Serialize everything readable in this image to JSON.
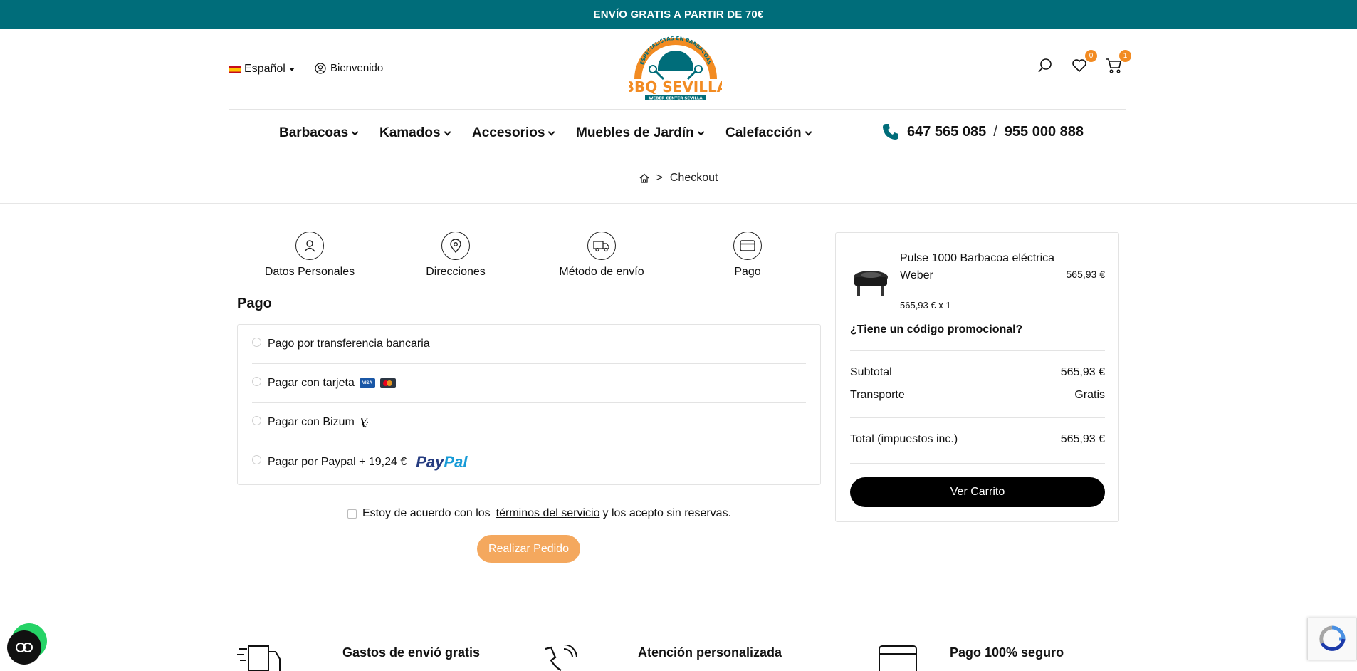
{
  "promo_bar": {
    "text": "ENVÍO GRATIS A PARTIR DE 70€"
  },
  "header": {
    "language": "Español",
    "welcome": "Bienvenido",
    "logo": {
      "brand": "BBQ SEVILLA",
      "arc_text": "ESPECIALISTAS EN BARBACOAS",
      "sub_text": "WEBER CENTER SEVILLA"
    },
    "wishlist_count": "0",
    "cart_count": "1"
  },
  "nav": {
    "items": [
      {
        "label": "Barbacoas"
      },
      {
        "label": "Kamados"
      },
      {
        "label": "Accesorios"
      },
      {
        "label": "Muebles de Jardín"
      },
      {
        "label": "Calefacción"
      }
    ],
    "phone_1": "647 565 085",
    "phone_separator": "/",
    "phone_2": "955 000 888"
  },
  "breadcrumb": {
    "separator": ">",
    "current": "Checkout"
  },
  "steps": [
    {
      "label": "Datos Personales",
      "icon": "user-icon"
    },
    {
      "label": "Direcciones",
      "icon": "location-pin-icon"
    },
    {
      "label": "Método de envío",
      "icon": "truck-icon"
    },
    {
      "label": "Pago",
      "icon": "credit-card-icon"
    }
  ],
  "payment": {
    "title": "Pago",
    "options": [
      {
        "label": "Pago por transferencia bancaria"
      },
      {
        "label": "Pagar con tarjeta"
      },
      {
        "label": "Pagar con Bizum"
      },
      {
        "label": "Pagar por Paypal + 19,24 €",
        "brand_a": "Pay",
        "brand_b": "Pal"
      }
    ],
    "card_logos": [
      "VISA",
      "mastercard"
    ]
  },
  "terms": {
    "before": "Estoy de acuerdo con los",
    "link": "términos del servicio",
    "after": "y los acepto sin reservas."
  },
  "place_order_label": "Realizar Pedido",
  "summary": {
    "product_name": "Pulse 1000 Barbacoa eléctrica Weber",
    "product_unit_price": "565,93 €",
    "product_qty_sep": "x",
    "product_qty": "1",
    "product_total": "565,93 €",
    "promo_label": "¿Tiene un código promocional?",
    "subtotal_label": "Subtotal",
    "subtotal_value": "565,93 €",
    "shipping_label": "Transporte",
    "shipping_value": "Gratis",
    "total_label": "Total (impuestos inc.)",
    "total_value": "565,93 €",
    "cart_button": "Ver Carrito"
  },
  "features": [
    {
      "label": "Gastos de envió gratis"
    },
    {
      "label": "Atención personalizada"
    },
    {
      "label": "Pago 100% seguro"
    }
  ],
  "colors": {
    "teal": "#006d7a",
    "orange": "#f28b22",
    "order_button": "#f4a85e",
    "whatsapp": "#25d366"
  }
}
